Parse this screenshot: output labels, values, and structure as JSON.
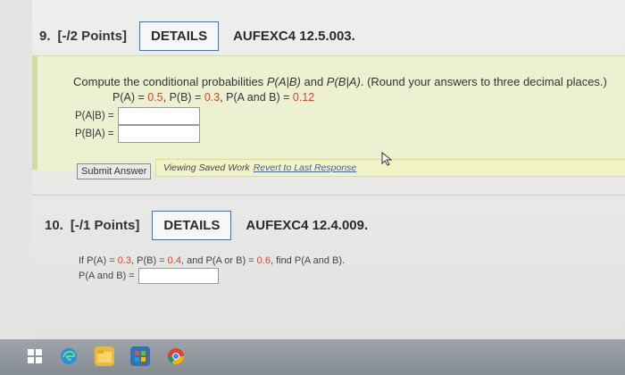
{
  "q9": {
    "number": "9.",
    "points": "[-/2 Points]",
    "details_label": "DETAILS",
    "code": "AUFEXC4 12.5.003.",
    "prompt_start": "Compute the conditional probabilities ",
    "prompt_p1": "P(A|B)",
    "prompt_and": " and ",
    "prompt_p2": "P(B|A)",
    "prompt_end": ". (Round your answers to three decimal places.)",
    "given_pa_label": "P(A) = ",
    "given_pa_val": "0.5",
    "given_pb_label": ", P(B) = ",
    "given_pb_val": "0.3",
    "given_pab_label": ", P(A and B) = ",
    "given_pab_val": "0.12",
    "answer1_label": "P(A|B) =",
    "answer2_label": "P(B|A) =",
    "answer1_value": "",
    "answer2_value": "",
    "submit_label": "Submit Answer",
    "saved_text": "Viewing Saved Work",
    "revert_link": "Revert to Last Response"
  },
  "q10": {
    "number": "10.",
    "points": "[-/1 Points]",
    "details_label": "DETAILS",
    "code": "AUFEXC4 12.4.009.",
    "text_start": "If P(A) = ",
    "pa_val": "0.3",
    "text_mid1": ", P(B) = ",
    "pb_val": "0.4",
    "text_mid2": ", and P(A or B) = ",
    "paorb_val": "0.6",
    "text_end": ", find P(A and B).",
    "answer_label": "P(A and B) =",
    "answer_value": ""
  },
  "taskbar": {
    "icons": [
      "windows-start-icon",
      "edge-icon",
      "file-explorer-icon",
      "store-icon",
      "chrome-icon"
    ]
  },
  "colors": {
    "accent_red": "#d2462f",
    "details_border": "#4a6fa5",
    "question_highlight": "#eef0d2"
  }
}
